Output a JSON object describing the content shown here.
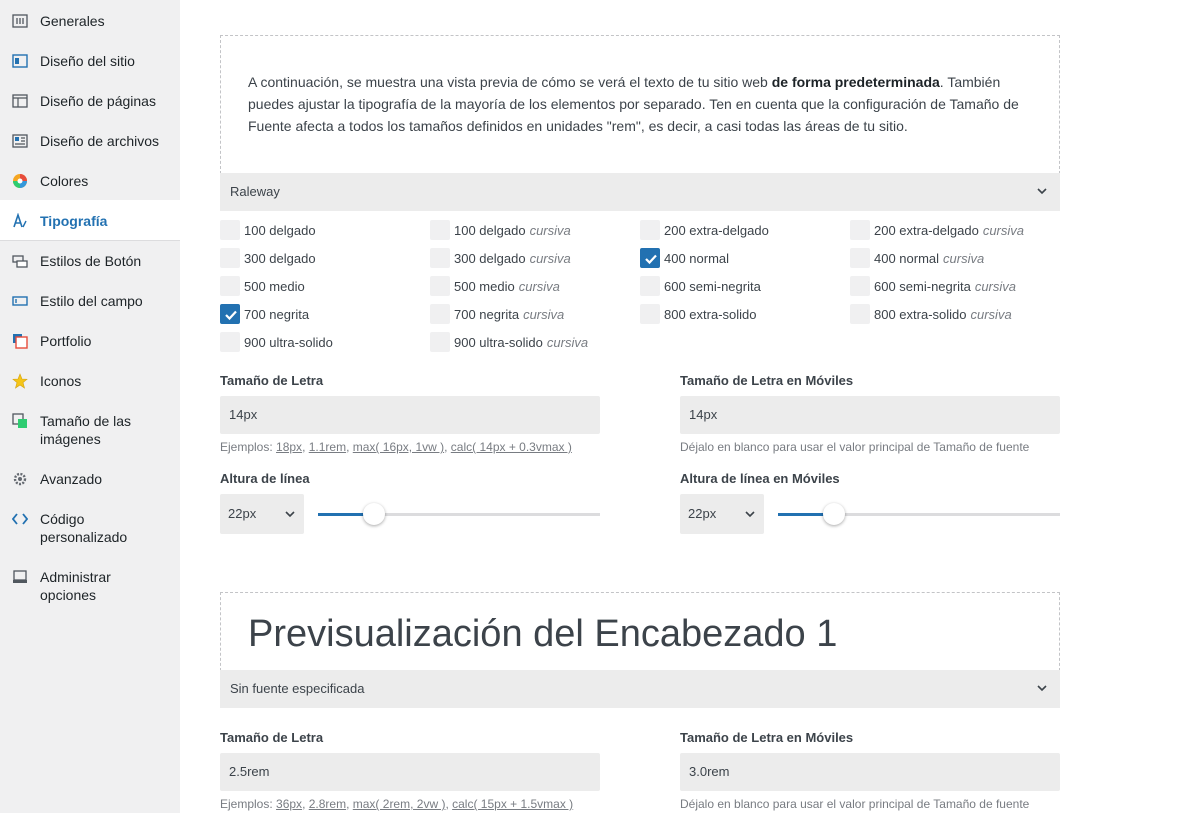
{
  "sidebar": {
    "items": [
      {
        "label": "Generales",
        "icon": "sliders-icon"
      },
      {
        "label": "Diseño del sitio",
        "icon": "site-layout-icon"
      },
      {
        "label": "Diseño de páginas",
        "icon": "page-layout-icon"
      },
      {
        "label": "Diseño de archivos",
        "icon": "archive-layout-icon"
      },
      {
        "label": "Colores",
        "icon": "color-wheel-icon"
      },
      {
        "label": "Tipografía",
        "icon": "typography-icon",
        "active": true
      },
      {
        "label": "Estilos de Botón",
        "icon": "button-icon"
      },
      {
        "label": "Estilo del campo",
        "icon": "field-icon"
      },
      {
        "label": "Portfolio",
        "icon": "portfolio-icon"
      },
      {
        "label": "Iconos",
        "icon": "star-icon"
      },
      {
        "label": "Tamaño de las imágenes",
        "icon": "image-size-icon"
      },
      {
        "label": "Avanzado",
        "icon": "gear-icon"
      },
      {
        "label": "Código personalizado",
        "icon": "code-icon"
      },
      {
        "label": "Administrar opciones",
        "icon": "manage-icon"
      }
    ]
  },
  "body_section": {
    "preview_text_before": "A continuación, se muestra una vista previa de cómo se verá el texto de tu sitio web ",
    "preview_text_bold": "de forma predeterminada",
    "preview_text_after": ". También puedes ajustar la tipografía de la mayoría de los elementos por separado. Ten en cuenta que la configuración de Tamaño de Fuente afecta a todos los tamaños definidos en unidades \"rem\", es decir, a casi todas las áreas de tu sitio.",
    "font_family": "Raleway",
    "weights": [
      {
        "label": "100 delgado",
        "italic": "",
        "checked": false
      },
      {
        "label": "100 delgado",
        "italic": "cursiva",
        "checked": false
      },
      {
        "label": "200 extra-delgado",
        "italic": "",
        "checked": false
      },
      {
        "label": "200 extra-delgado",
        "italic": "cursiva",
        "checked": false
      },
      {
        "label": "300 delgado",
        "italic": "",
        "checked": false
      },
      {
        "label": "300 delgado",
        "italic": "cursiva",
        "checked": false
      },
      {
        "label": "400 normal",
        "italic": "",
        "checked": true
      },
      {
        "label": "400 normal",
        "italic": "cursiva",
        "checked": false
      },
      {
        "label": "500 medio",
        "italic": "",
        "checked": false
      },
      {
        "label": "500 medio",
        "italic": "cursiva",
        "checked": false
      },
      {
        "label": "600 semi-negrita",
        "italic": "",
        "checked": false
      },
      {
        "label": "600 semi-negrita",
        "italic": "cursiva",
        "checked": false
      },
      {
        "label": "700 negrita",
        "italic": "",
        "checked": true
      },
      {
        "label": "700 negrita",
        "italic": "cursiva",
        "checked": false
      },
      {
        "label": "800 extra-solido",
        "italic": "",
        "checked": false
      },
      {
        "label": "800 extra-solido",
        "italic": "cursiva",
        "checked": false
      },
      {
        "label": "900 ultra-solido",
        "italic": "",
        "checked": false
      },
      {
        "label": "900 ultra-solido",
        "italic": "cursiva",
        "checked": false
      }
    ],
    "font_size_label": "Tamaño de Letra",
    "font_size_value": "14px",
    "font_size_help_prefix": "Ejemplos: ",
    "font_size_examples": [
      "18px",
      "1.1rem",
      "max( 16px, 1vw )",
      "calc( 14px + 0.3vmax )"
    ],
    "mobile_size_label": "Tamaño de Letra en Móviles",
    "mobile_size_value": "14px",
    "mobile_size_help": "Déjalo en blanco para usar el valor principal de Tamaño de fuente",
    "line_height_label": "Altura de línea",
    "line_height_value": "22px",
    "line_height_slider_fraction": 0.2,
    "mobile_line_height_label": "Altura de línea en Móviles",
    "mobile_line_height_value": "22px",
    "mobile_line_height_slider_fraction": 0.2
  },
  "h1_section": {
    "preview_heading": "Previsualización del Encabezado 1",
    "font_family": "Sin fuente especificada",
    "font_size_label": "Tamaño de Letra",
    "font_size_value": "2.5rem",
    "font_size_help_prefix": "Ejemplos: ",
    "font_size_examples": [
      "36px",
      "2.8rem",
      "max( 2rem, 2vw )",
      "calc( 15px + 1.5vmax )"
    ],
    "mobile_size_label": "Tamaño de Letra en Móviles",
    "mobile_size_value": "3.0rem",
    "mobile_size_help": "Déjalo en blanco para usar el valor principal de Tamaño de fuente"
  },
  "colors": {
    "accent": "#2271b1",
    "sidebar_bg": "#f0f0f1",
    "input_bg": "#ececec"
  }
}
